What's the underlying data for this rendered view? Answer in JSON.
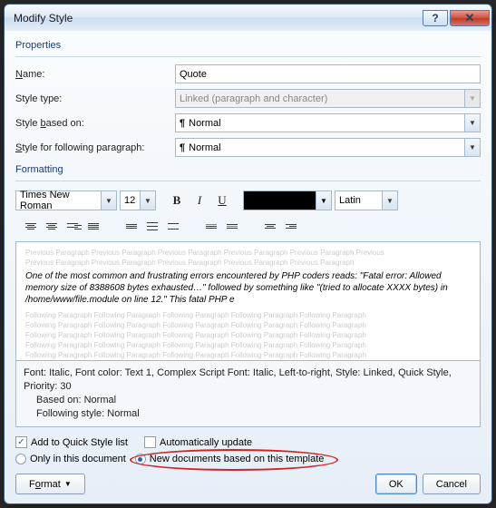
{
  "title": "Modify Style",
  "groups": {
    "properties": "Properties",
    "formatting": "Formatting"
  },
  "props": {
    "name_label": "Name:",
    "name_value": "Quote",
    "type_label": "Style type:",
    "type_value": "Linked (paragraph and character)",
    "based_label": "Style based on:",
    "based_value": "Normal",
    "following_label": "Style for following paragraph:",
    "following_value": "Normal"
  },
  "format": {
    "font": "Times New Roman",
    "size": "12",
    "script": "Latin"
  },
  "preview": {
    "ghost_prev": "Previous Paragraph Previous Paragraph Previous Paragraph Previous Paragraph Previous Paragraph Previous",
    "ghost_prev2": "Previous Paragraph Previous Paragraph Previous Paragraph Previous Paragraph Previous Paragraph",
    "sample": "One of the most common and frustrating errors encountered by PHP coders reads: \"Fatal error: Allowed memory size of 8388608 bytes exhausted…\" followed by something like \"(tried to allocate XXXX bytes) in /home/www/file.module on line 12.\" This fatal PHP e",
    "ghost_follow": "Following Paragraph Following Paragraph Following Paragraph Following Paragraph Following Paragraph"
  },
  "summary": {
    "line1": "Font: Italic, Font color: Text 1, Complex Script Font: Italic, Left-to-right, Style: Linked, Quick Style,",
    "line2": "Priority: 30",
    "line3": "Based on: Normal",
    "line4": "Following style: Normal"
  },
  "options": {
    "quicklist": "Add to Quick Style list",
    "autoupdate": "Automatically update",
    "onlydoc": "Only in this document",
    "newdocs": "New documents based on this template"
  },
  "buttons": {
    "format": "Format",
    "ok": "OK",
    "cancel": "Cancel"
  }
}
